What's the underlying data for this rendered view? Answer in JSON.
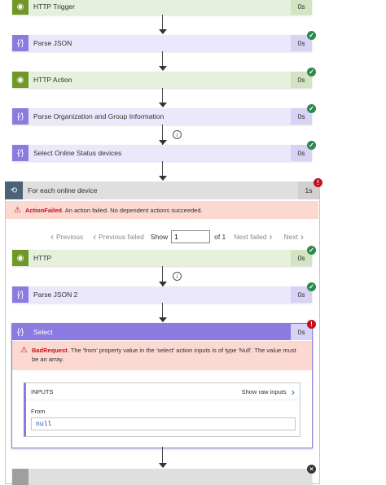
{
  "steps": {
    "http_trigger": {
      "label": "HTTP Trigger",
      "duration": "0s"
    },
    "parse_json": {
      "label": "Parse JSON",
      "duration": "0s"
    },
    "http_action": {
      "label": "HTTP Action",
      "duration": "0s"
    },
    "parse_org": {
      "label": "Parse Organization and Group Information",
      "duration": "0s"
    },
    "select_online": {
      "label": "Select Online Status devices",
      "duration": "0s"
    }
  },
  "foreach": {
    "label": "For each online device",
    "duration": "1s",
    "error_title": "ActionFailed",
    "error_text": ". An action failed. No dependent actions succeeded.",
    "pager": {
      "previous": "Previous",
      "previous_failed": "Previous failed",
      "show": "Show",
      "page_value": "1",
      "of": "of 1",
      "next_failed": "Next failed",
      "next": "Next"
    },
    "http": {
      "label": "HTTP",
      "duration": "0s"
    },
    "parse_json_2": {
      "label": "Parse JSON 2",
      "duration": "0s"
    },
    "select": {
      "label": "Select",
      "duration": "0s",
      "error_title": "BadRequest",
      "error_text": ". The 'from' property value in the 'select' action inputs is of type 'Null'. The value must be an array.",
      "inputs_title": "INPUTS",
      "show_raw": "Show raw inputs",
      "from_label": "From",
      "from_value": "null"
    }
  },
  "icons": {
    "check": "✓",
    "error": "!",
    "close": "×",
    "info": "i",
    "chevron_left": "‹",
    "chevron_right": "›"
  }
}
